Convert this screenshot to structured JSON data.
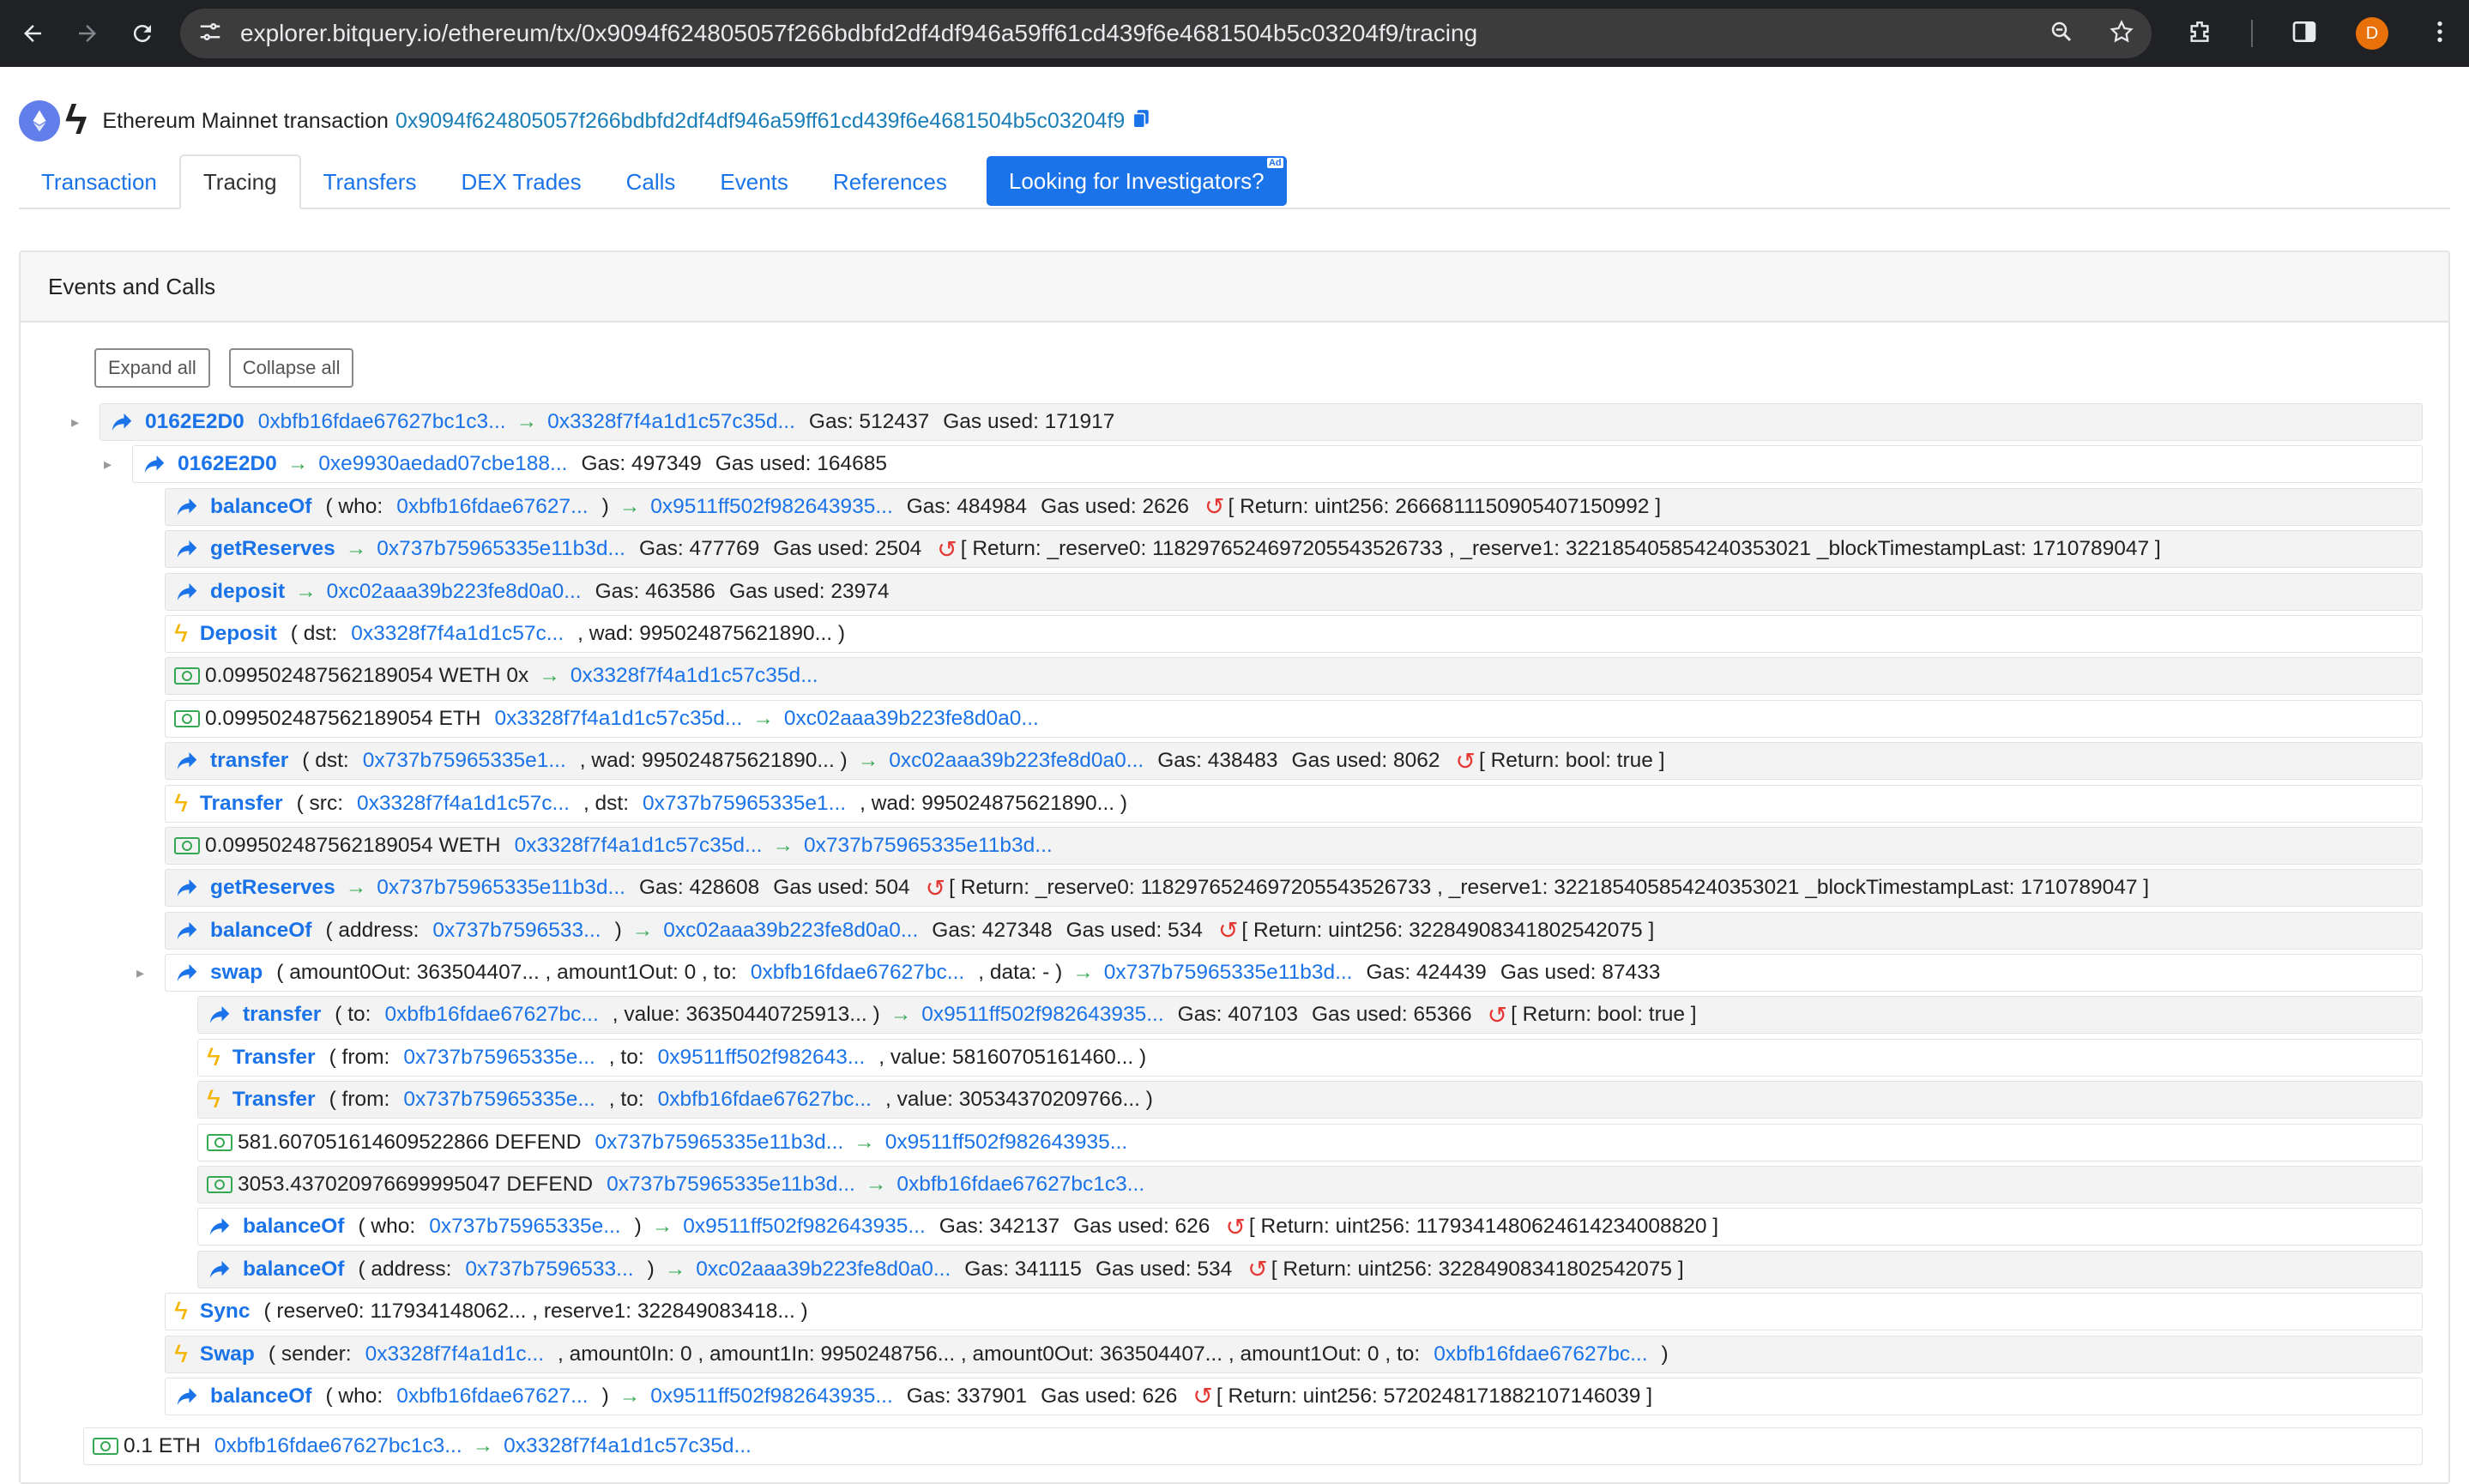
{
  "browser": {
    "url": "explorer.bitquery.io/ethereum/tx/0x9094f624805057f266bdbfd2df4df946a59ff61cd439f6e4681504b5c03204f9/tracing",
    "avatar_letter": "D"
  },
  "header": {
    "title": "Ethereum Mainnet transaction",
    "hash": "0x9094f624805057f266bdbfd2df4df946a59ff61cd439f6e4681504b5c03204f9"
  },
  "tabs": [
    {
      "label": "Transaction"
    },
    {
      "label": "Tracing"
    },
    {
      "label": "Transfers"
    },
    {
      "label": "DEX Trades"
    },
    {
      "label": "Calls"
    },
    {
      "label": "Events"
    },
    {
      "label": "References"
    }
  ],
  "cta": {
    "label": "Looking for Investigators?",
    "ad": "Ad"
  },
  "card": {
    "title": "Events and Calls",
    "expand_all": "Expand all",
    "collapse_all": "Collapse all"
  },
  "rows": [
    {
      "indent": 0,
      "caret": true,
      "kind": "call",
      "bg": "grey",
      "parts": [
        {
          "t": "0162E2D0",
          "c": "method"
        },
        {
          "t": "0xbfb16fdae67627bc1c3...",
          "c": "lnk"
        },
        {
          "t": "→",
          "c": "arr"
        },
        {
          "t": "0x3328f7f4a1d1c57c35d...",
          "c": "lnk"
        },
        {
          "t": "Gas: 512437"
        },
        {
          "t": "Gas used: 171917"
        }
      ]
    },
    {
      "indent": 1,
      "caret": true,
      "kind": "call",
      "bg": "white",
      "parts": [
        {
          "t": "0162E2D0",
          "c": "method"
        },
        {
          "t": "→",
          "c": "arr"
        },
        {
          "t": "0xe9930aedad07cbe188...",
          "c": "lnk"
        },
        {
          "t": "Gas: 497349"
        },
        {
          "t": "Gas used: 164685"
        }
      ]
    },
    {
      "indent": 2,
      "kind": "call",
      "bg": "grey",
      "parts": [
        {
          "t": "balanceOf",
          "c": "method"
        },
        {
          "t": "( who:"
        },
        {
          "t": "0xbfb16fdae67627...",
          "c": "lnk"
        },
        {
          "t": ")"
        },
        {
          "t": "→",
          "c": "arr"
        },
        {
          "t": "0x9511ff502f982643935...",
          "c": "lnk"
        },
        {
          "t": "Gas: 484984"
        },
        {
          "t": "Gas used: 2626"
        },
        {
          "t": "↺",
          "c": "ret"
        },
        {
          "t": "[ Return: uint256: 2666811150905407150992 ]"
        }
      ]
    },
    {
      "indent": 2,
      "kind": "call",
      "bg": "grey",
      "parts": [
        {
          "t": "getReserves",
          "c": "method"
        },
        {
          "t": "→",
          "c": "arr"
        },
        {
          "t": "0x737b75965335e11b3d...",
          "c": "lnk"
        },
        {
          "t": "Gas: 477769"
        },
        {
          "t": "Gas used: 2504"
        },
        {
          "t": "↺",
          "c": "ret"
        },
        {
          "t": "[ Return: _reserve0: 118297652469720554352673​3 , _reserve1: 322185405854240353021 _blockTimestampLast: 1710789047 ]"
        }
      ]
    },
    {
      "indent": 2,
      "kind": "call",
      "bg": "grey",
      "parts": [
        {
          "t": "deposit",
          "c": "method"
        },
        {
          "t": "→",
          "c": "arr"
        },
        {
          "t": "0xc02aaa39b223fe8d0a0...",
          "c": "lnk"
        },
        {
          "t": "Gas: 463586"
        },
        {
          "t": "Gas used: 23974"
        }
      ]
    },
    {
      "indent": 2,
      "kind": "event",
      "bg": "white",
      "parts": [
        {
          "t": "Deposit",
          "c": "method"
        },
        {
          "t": "( dst:"
        },
        {
          "t": "0x3328f7f4a1d1c57c...",
          "c": "lnk"
        },
        {
          "t": ", wad: 995024875621890... )"
        }
      ]
    },
    {
      "indent": 2,
      "kind": "money",
      "bg": "grey",
      "parts": [
        {
          "t": "0.099502487562189054 WETH 0x"
        },
        {
          "t": "→",
          "c": "arr"
        },
        {
          "t": "0x3328f7f4a1d1c57c35d...",
          "c": "lnk"
        }
      ]
    },
    {
      "indent": 2,
      "kind": "money",
      "bg": "white",
      "parts": [
        {
          "t": "0.099502487562189054 ETH"
        },
        {
          "t": "0x3328f7f4a1d1c57c35d...",
          "c": "lnk"
        },
        {
          "t": "→",
          "c": "arr"
        },
        {
          "t": "0xc02aaa39b223fe8d0a0...",
          "c": "lnk"
        }
      ]
    },
    {
      "indent": 2,
      "kind": "call",
      "bg": "grey",
      "parts": [
        {
          "t": "transfer",
          "c": "method"
        },
        {
          "t": "( dst:"
        },
        {
          "t": "0x737b75965335e1...",
          "c": "lnk"
        },
        {
          "t": ", wad: 995024875621890... )"
        },
        {
          "t": "→",
          "c": "arr"
        },
        {
          "t": "0xc02aaa39b223fe8d0a0...",
          "c": "lnk"
        },
        {
          "t": "Gas: 438483"
        },
        {
          "t": "Gas used: 8062"
        },
        {
          "t": "↺",
          "c": "ret"
        },
        {
          "t": "[ Return: bool: true ]"
        }
      ]
    },
    {
      "indent": 2,
      "kind": "event",
      "bg": "white",
      "parts": [
        {
          "t": "Transfer",
          "c": "method"
        },
        {
          "t": "( src:"
        },
        {
          "t": "0x3328f7f4a1d1c57c...",
          "c": "lnk"
        },
        {
          "t": ", dst:"
        },
        {
          "t": "0x737b75965335e1...",
          "c": "lnk"
        },
        {
          "t": ", wad: 995024875621890... )"
        }
      ]
    },
    {
      "indent": 2,
      "kind": "money",
      "bg": "grey",
      "parts": [
        {
          "t": "0.099502487562189054 WETH"
        },
        {
          "t": "0x3328f7f4a1d1c57c35d...",
          "c": "lnk"
        },
        {
          "t": "→",
          "c": "arr"
        },
        {
          "t": "0x737b75965335e11b3d...",
          "c": "lnk"
        }
      ]
    },
    {
      "indent": 2,
      "kind": "call",
      "bg": "grey",
      "parts": [
        {
          "t": "getReserves",
          "c": "method"
        },
        {
          "t": "→",
          "c": "arr"
        },
        {
          "t": "0x737b75965335e11b3d...",
          "c": "lnk"
        },
        {
          "t": "Gas: 428608"
        },
        {
          "t": "Gas used: 504"
        },
        {
          "t": "↺",
          "c": "ret"
        },
        {
          "t": "[ Return: _reserve0: 118297652469720554352673​3 , _reserve1: 322185405854240353021 _blockTimestampLast: 1710789047 ]"
        }
      ]
    },
    {
      "indent": 2,
      "kind": "call",
      "bg": "grey",
      "parts": [
        {
          "t": "balanceOf",
          "c": "method"
        },
        {
          "t": "( address:"
        },
        {
          "t": "0x737b7596533...",
          "c": "lnk"
        },
        {
          "t": ")"
        },
        {
          "t": "→",
          "c": "arr"
        },
        {
          "t": "0xc02aaa39b223fe8d0a0...",
          "c": "lnk"
        },
        {
          "t": "Gas: 427348"
        },
        {
          "t": "Gas used: 534"
        },
        {
          "t": "↺",
          "c": "ret"
        },
        {
          "t": "[ Return: uint256: 322849083418025420​75 ]"
        }
      ]
    },
    {
      "indent": 2,
      "caret": true,
      "kind": "call",
      "bg": "white",
      "parts": [
        {
          "t": "swap",
          "c": "method"
        },
        {
          "t": "( amount0Out: 363504407... , amount1Out: 0 , to:"
        },
        {
          "t": "0xbfb16fdae67627bc...",
          "c": "lnk"
        },
        {
          "t": ", data: - )"
        },
        {
          "t": "→",
          "c": "arr"
        },
        {
          "t": "0x737b75965335e11b3d...",
          "c": "lnk"
        },
        {
          "t": "Gas: 424439"
        },
        {
          "t": "Gas used: 87433"
        }
      ]
    },
    {
      "indent": 3,
      "kind": "call",
      "bg": "grey",
      "parts": [
        {
          "t": "transfer",
          "c": "method"
        },
        {
          "t": "( to:"
        },
        {
          "t": "0xbfb16fdae67627bc...",
          "c": "lnk"
        },
        {
          "t": ", value: 36350440725913... )"
        },
        {
          "t": "→",
          "c": "arr"
        },
        {
          "t": "0x9511ff502f982643935...",
          "c": "lnk"
        },
        {
          "t": "Gas: 407103"
        },
        {
          "t": "Gas used: 65366"
        },
        {
          "t": "↺",
          "c": "ret"
        },
        {
          "t": "[ Return: bool: true ]"
        }
      ]
    },
    {
      "indent": 3,
      "kind": "event",
      "bg": "white",
      "parts": [
        {
          "t": "Transfer",
          "c": "method"
        },
        {
          "t": "( from:"
        },
        {
          "t": "0x737b75965335e...",
          "c": "lnk"
        },
        {
          "t": ", to:"
        },
        {
          "t": "0x9511ff502f982643...",
          "c": "lnk"
        },
        {
          "t": ", value: 58160705161460... )"
        }
      ]
    },
    {
      "indent": 3,
      "kind": "event",
      "bg": "grey",
      "parts": [
        {
          "t": "Transfer",
          "c": "method"
        },
        {
          "t": "( from:"
        },
        {
          "t": "0x737b75965335e...",
          "c": "lnk"
        },
        {
          "t": ", to:"
        },
        {
          "t": "0xbfb16fdae67627bc...",
          "c": "lnk"
        },
        {
          "t": ", value: 30534370209766... )"
        }
      ]
    },
    {
      "indent": 3,
      "kind": "money",
      "bg": "white",
      "parts": [
        {
          "t": "581.607051614609522866 DEFEND"
        },
        {
          "t": "0x737b75965335e11b3d...",
          "c": "lnk"
        },
        {
          "t": "→",
          "c": "arr"
        },
        {
          "t": "0x9511ff502f982643935...",
          "c": "lnk"
        }
      ]
    },
    {
      "indent": 3,
      "kind": "money",
      "bg": "grey",
      "parts": [
        {
          "t": "3053.437020976699995047 DEFEND"
        },
        {
          "t": "0x737b75965335e11b3d...",
          "c": "lnk"
        },
        {
          "t": "→",
          "c": "arr"
        },
        {
          "t": "0xbfb16fdae67627bc1c3...",
          "c": "lnk"
        }
      ]
    },
    {
      "indent": 3,
      "kind": "call",
      "bg": "white",
      "parts": [
        {
          "t": "balanceOf",
          "c": "method"
        },
        {
          "t": "( who:"
        },
        {
          "t": "0x737b75965335e...",
          "c": "lnk"
        },
        {
          "t": ")"
        },
        {
          "t": "→",
          "c": "arr"
        },
        {
          "t": "0x9511ff502f982643935...",
          "c": "lnk"
        },
        {
          "t": "Gas: 342137"
        },
        {
          "t": "Gas used: 626"
        },
        {
          "t": "↺",
          "c": "ret"
        },
        {
          "t": "[ Return: uint256: 117934148062461423400882​0 ]"
        }
      ]
    },
    {
      "indent": 3,
      "kind": "call",
      "bg": "grey",
      "parts": [
        {
          "t": "balanceOf",
          "c": "method"
        },
        {
          "t": "( address:"
        },
        {
          "t": "0x737b7596533...",
          "c": "lnk"
        },
        {
          "t": ")"
        },
        {
          "t": "→",
          "c": "arr"
        },
        {
          "t": "0xc02aaa39b223fe8d0a0...",
          "c": "lnk"
        },
        {
          "t": "Gas: 341115"
        },
        {
          "t": "Gas used: 534"
        },
        {
          "t": "↺",
          "c": "ret"
        },
        {
          "t": "[ Return: uint256: 322849083418025420​75 ]"
        }
      ]
    },
    {
      "indent": 2,
      "kind": "event",
      "bg": "white",
      "parts": [
        {
          "t": "Sync",
          "c": "method"
        },
        {
          "t": "( reserve0: 117934148062... , reserve1: 322849083418... )"
        }
      ]
    },
    {
      "indent": 2,
      "kind": "event",
      "bg": "grey",
      "parts": [
        {
          "t": "Swap",
          "c": "method"
        },
        {
          "t": "( sender:"
        },
        {
          "t": "0x3328f7f4a1d1c...",
          "c": "lnk"
        },
        {
          "t": ", amount0In: 0 , amount1In: 9950248756... , amount0Out: 363504407... , amount1Out: 0 , to:"
        },
        {
          "t": "0xbfb16fdae67627bc...",
          "c": "lnk"
        },
        {
          "t": ")"
        }
      ]
    },
    {
      "indent": 2,
      "kind": "call",
      "bg": "white",
      "parts": [
        {
          "t": "balanceOf",
          "c": "method"
        },
        {
          "t": "( who:"
        },
        {
          "t": "0xbfb16fdae67627...",
          "c": "lnk"
        },
        {
          "t": ")"
        },
        {
          "t": "→",
          "c": "arr"
        },
        {
          "t": "0x9511ff502f982643935...",
          "c": "lnk"
        },
        {
          "t": "Gas: 337901"
        },
        {
          "t": "Gas used: 626"
        },
        {
          "t": "↺",
          "c": "ret"
        },
        {
          "t": "[ Return: uint256: 572024817188210714603​9 ]"
        }
      ]
    },
    {
      "indent": -0.5,
      "kind": "money",
      "bg": "white",
      "gapTop": true,
      "parts": [
        {
          "t": "0.1 ETH"
        },
        {
          "t": "0xbfb16fdae67627bc1c3...",
          "c": "lnk"
        },
        {
          "t": "→",
          "c": "arr"
        },
        {
          "t": "0x3328f7f4a1d1c57c35d...",
          "c": "lnk"
        }
      ]
    }
  ],
  "colors": {
    "link": "#1a73e8",
    "event_bolt": "#f4b400",
    "arrow": "#34a853",
    "return_icon": "#e53935",
    "cta_bg": "#1a73e8"
  }
}
